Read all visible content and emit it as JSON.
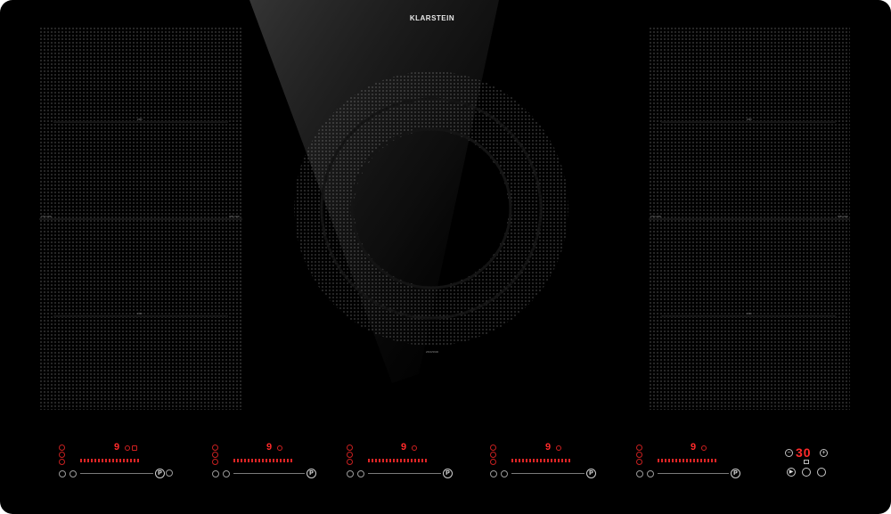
{
  "brand": "KLARSTEIN",
  "left_zone": {
    "top_label": "2300",
    "mid_left_label": "3700 2300",
    "mid_right_label": "3650 1900",
    "bottom_label": "2300"
  },
  "center_zone": {
    "label": "2600/3600"
  },
  "right_zone": {
    "top_label": "2300",
    "mid_left_label": "3700 2300",
    "mid_right_label": "3650 1900",
    "bottom_label": "2300"
  },
  "cooking_zones": [
    {
      "level": "9",
      "boost": "P"
    },
    {
      "level": "9",
      "boost": "P"
    },
    {
      "level": "9",
      "boost": "P"
    },
    {
      "level": "9",
      "boost": "P"
    },
    {
      "level": "9",
      "boost": "P"
    }
  ],
  "timer": {
    "value": "30",
    "minus": "−",
    "plus": "+"
  },
  "colors": {
    "glass": "#000000",
    "display_red": "#ff2a2a",
    "dots": "#aaaaaa"
  },
  "icons": [
    "up-arrow-icon",
    "down-arrow-icon",
    "power-icon",
    "timer-icon",
    "keep-warm-icon",
    "lock-icon",
    "play-icon",
    "pause-icon",
    "boost-icon"
  ]
}
